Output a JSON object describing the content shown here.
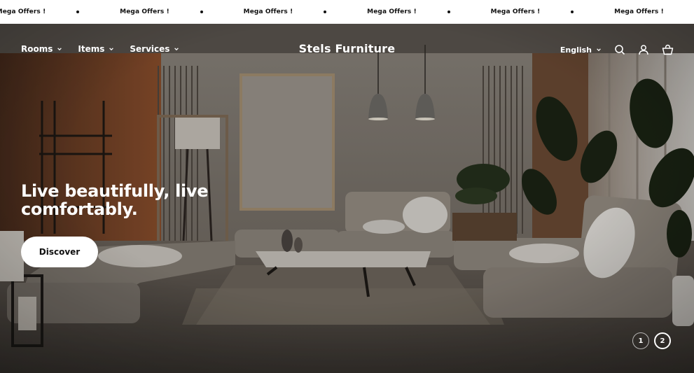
{
  "announcement": {
    "items": [
      "Mega Offers !",
      "Mega Offers !",
      "Mega Offers !",
      "Mega Offers !",
      "Mega Offers !",
      "Mega Offers !"
    ]
  },
  "header": {
    "logo": "Stels Furniture",
    "nav": [
      {
        "label": "Rooms"
      },
      {
        "label": "Items"
      },
      {
        "label": "Services"
      }
    ],
    "language": "English",
    "icons": [
      "search-icon",
      "account-icon",
      "cart-icon"
    ]
  },
  "hero": {
    "headline": "Live beautifully, live comfortably.",
    "cta_label": "Discover",
    "pager": [
      "1",
      "2"
    ],
    "active_slide": "2"
  },
  "colors": {
    "text_on_hero": "#ffffff",
    "button_bg": "#ffffff",
    "button_text": "#111111"
  }
}
